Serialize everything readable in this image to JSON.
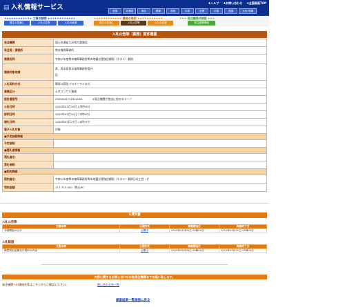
{
  "header": {
    "logo": "入札情報サービス",
    "links": [
      "✚ヘルプ",
      "✚お問い合わせ",
      "✚全国画面TOP"
    ],
    "regions": [
      "全国",
      "北海道",
      "東北",
      "関東",
      "北陸",
      "中部",
      "近畿",
      "中国",
      "四国",
      "九州/沖縄"
    ]
  },
  "search": {
    "construction_title": "✦✦✦✦✦✦✦✦✦✦✦✦ 工事の検索 ✦✦✦✦✦✦✦✦✦✦✦✦",
    "service_title": "✦✦✦✦✦✦✦✦✦✦✦✦ 業務の検索 ✦✦✦✦✦✦✦✦✦✦✦",
    "org_title": "✦✦✦ 発注機関の検索 ✦✦✦",
    "construction_buttons": [
      "発注の見通し",
      "入札公告等",
      "入札の経過"
    ],
    "service_buttons": [
      "発注の見通し",
      "入札公告等",
      "入札の経過"
    ],
    "org_buttons": [
      "発注機関情報"
    ]
  },
  "page_title": "入札公告等（業務）案件概要",
  "info_rows": [
    {
      "label": "発注機関",
      "value": "国土交通省九州地方整備局"
    },
    {
      "label": "発注局・事務所",
      "value": "熊本復興事務所"
    },
    {
      "label": "業務名称",
      "value": "令和２年度熊本復興事務所熊本地震災害復旧補助（その３）業務"
    },
    {
      "label": "業務対象地域",
      "value": "県：熊本県熊本復興事務所管内",
      "value2": "区："
    },
    {
      "label": "入札契約方式",
      "value": "簡易公募型プロポーザル方式"
    },
    {
      "label": "業務区分",
      "value": "土木コンサル業務"
    },
    {
      "label": "設計書番号",
      "value": "2020000741610004",
      "note": "※発注機関が独自に定めるコード"
    },
    {
      "label": "公告日時",
      "value": "2020年01月30日 07時30分"
    },
    {
      "label": "説明日時",
      "value": "2020年02月20日 17時00分"
    },
    {
      "label": "開札日時",
      "value": "2020年03月25日 11時07分"
    },
    {
      "label": "電子入札対象",
      "value": "対象"
    }
  ],
  "sections": {
    "planned": {
      "title": "■予定価格情報",
      "rows": [
        {
          "label": "予定価格",
          "value": ""
        }
      ]
    },
    "winner": {
      "title": "■落札者情報",
      "rows": [
        {
          "label": "落札者名",
          "value": ""
        },
        {
          "label": "落札価格",
          "value": ""
        }
      ]
    },
    "contract": {
      "title": "■契約情報",
      "rows": [
        {
          "label": "契約者名",
          "value": "令和２年度熊本復興事務所熊本地震災害復旧補助（その３）業務日本工営・セ"
        },
        {
          "label": "契約金額",
          "value": "117,315,000（税込み）"
        }
      ]
    }
  },
  "documents": {
    "title": "公開文書",
    "headers": [
      "文書名称",
      "公開形式",
      "掲載開始日",
      "掲載終了日"
    ],
    "groups": [
      {
        "name": "入札公告等",
        "rows": [
          [
            "手続開始の公示",
            "公開中",
            "2020年01月30日 09時00分",
            "2021年03月31日 23時00分"
          ]
        ]
      },
      {
        "name": "入札経過",
        "rows": [
          [
            "随意契約結果及び契約の内容",
            "公開中",
            "2020年04月08日 08時00分",
            "2021年03月31日 23時00分"
          ]
        ]
      }
    ]
  },
  "footer": {
    "contact_bar": "内容に関するお問い合わせは各発注機関までお願い致します。",
    "contact_text": "発注機関への連絡先等はこちらからご確認ください。",
    "contact_link": "問い合わせ先一覧",
    "back_link": "検索結果一覧画面に戻る"
  }
}
